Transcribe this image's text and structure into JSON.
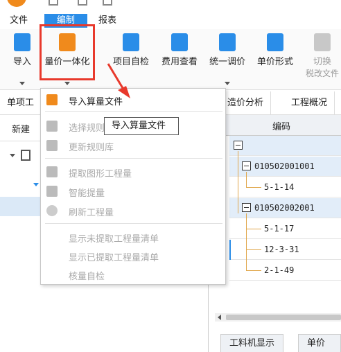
{
  "menubar": {
    "file": "文件",
    "edit": "编制",
    "report": "报表"
  },
  "ribbon": {
    "import": "导入",
    "quantity_price": "量价一体化",
    "self_check": "项目自检",
    "cost_view": "费用查看",
    "unify_adjust": "统一调价",
    "unit_form": "单价形式",
    "switch": "切换",
    "switch_sub": "税改文件"
  },
  "tabs": {
    "sub_project": "单项工",
    "cost_analysis": "造价分析",
    "project_overview": "工程概况"
  },
  "left": {
    "new": "新建"
  },
  "grid": {
    "header_code": "编码",
    "rows": [
      {
        "code": "",
        "level": 0
      },
      {
        "code": "010502001001",
        "level": 1
      },
      {
        "code": "5-1-14",
        "level": 2
      },
      {
        "code": "010502002001",
        "level": 1
      },
      {
        "code": "5-1-17",
        "level": 2
      },
      {
        "code": "12-3-31",
        "level": 2
      },
      {
        "code": "2-1-49",
        "level": 2
      }
    ]
  },
  "bottom_tabs": {
    "labor_machine": "工料机显示",
    "unit_price": "单价构"
  },
  "dropdown": {
    "import_qty_file": "导入算量文件",
    "select_rules": "选择规则",
    "update_rules": "更新规则库",
    "extract_graphic_qty": "提取图形工程量",
    "smart_extract": "智能提量",
    "refresh_qty": "刷新工程量",
    "show_unextracted": "显示未提取工程量清单",
    "show_extracted": "显示已提取工程量清单",
    "qty_self_check": "核量自检"
  },
  "tooltip": "导入算量文件",
  "colors": {
    "accent": "#2a8de8",
    "highlight_border": "#e8392c",
    "tree_line": "#e0a64a"
  }
}
